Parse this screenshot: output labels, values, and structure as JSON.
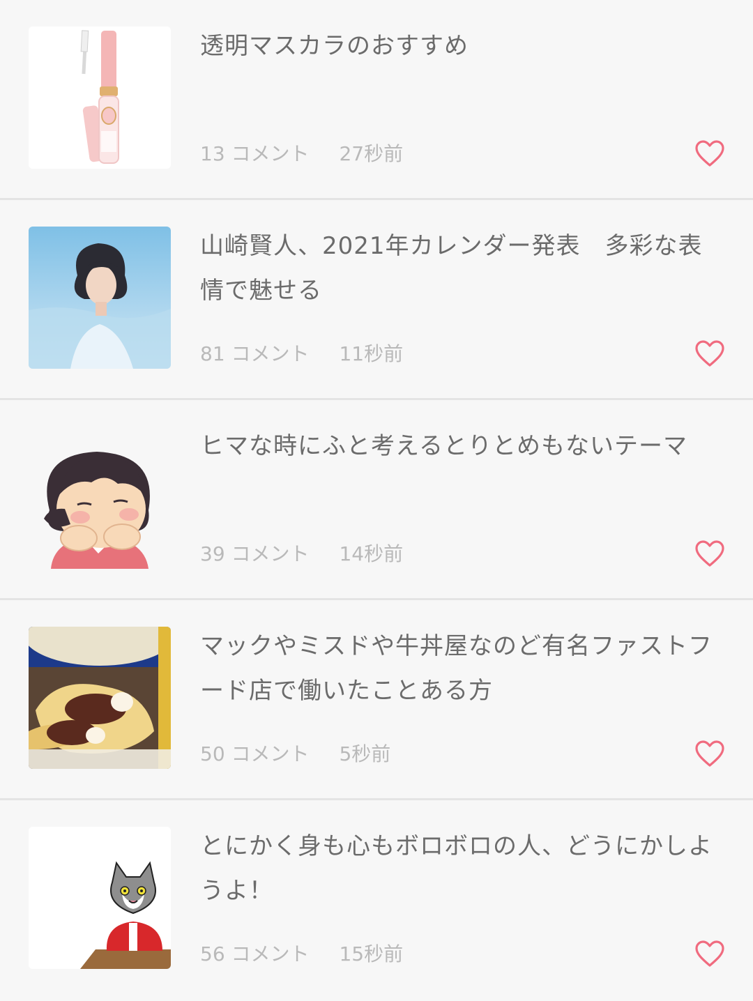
{
  "accent_color": "#f06b7f",
  "topics": [
    {
      "title": "透明マスカラのおすすめ",
      "comments": "13",
      "comment_suffix": "コメント",
      "time": "27秒前",
      "thumbnail": "clear-mascara-product-image"
    },
    {
      "title": "山崎賢人、2021年カレンダー発表　多彩な表情で魅せる",
      "comments": "81",
      "comment_suffix": "コメント",
      "time": "11秒前",
      "thumbnail": "calendar-cover-photo"
    },
    {
      "title": "ヒマな時にふと考えるとりとめもないテーマ",
      "comments": "39",
      "comment_suffix": "コメント",
      "time": "14秒前",
      "thumbnail": "daydreaming-girl-illustration"
    },
    {
      "title": "マックやミスドや牛丼屋なのど有名ファストフード店で働いたことある方",
      "comments": "50",
      "comment_suffix": "コメント",
      "time": "5秒前",
      "thumbnail": "red-bean-pie-photo"
    },
    {
      "title": "とにかく身も心もボロボロの人、どうにかしようよ！",
      "comments": "56",
      "comment_suffix": "コメント",
      "time": "15秒前",
      "thumbnail": "cat-worker-illustration"
    }
  ],
  "icons": {
    "favorite": "heart-outline-icon"
  }
}
